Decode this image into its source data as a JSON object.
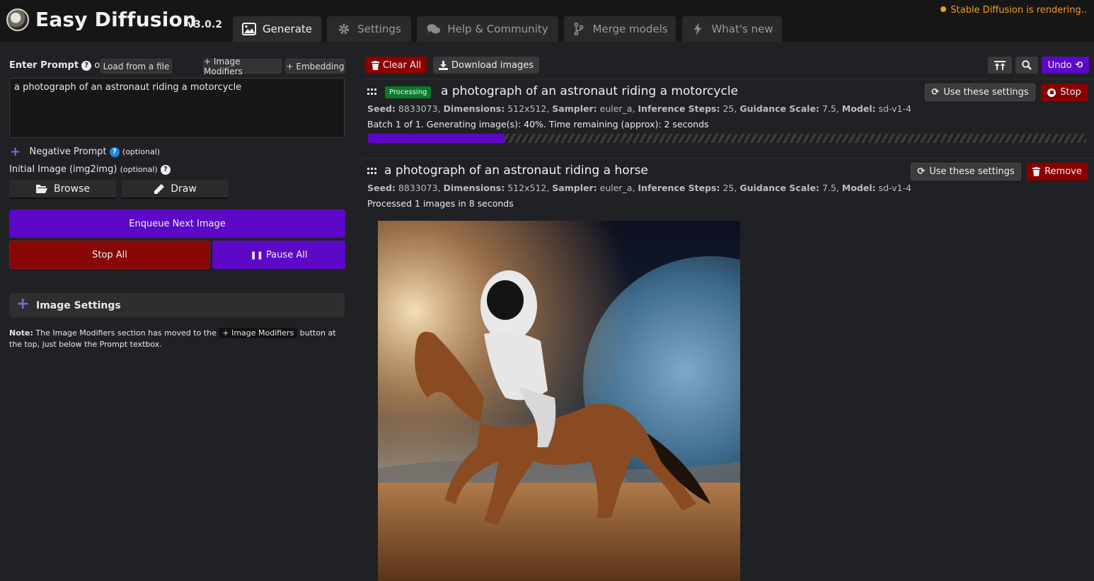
{
  "app": {
    "title": "Easy Diffusion",
    "version": "v3.0.2",
    "status": "Stable Diffusion is rendering.."
  },
  "tabs": [
    {
      "label": "Generate",
      "icon": "image-icon"
    },
    {
      "label": "Settings",
      "icon": "gear-icon"
    },
    {
      "label": "Help & Community",
      "icon": "comments-icon"
    },
    {
      "label": "Merge models",
      "icon": "code-branch-icon"
    },
    {
      "label": "What's new",
      "icon": "bolt-icon"
    }
  ],
  "left": {
    "enter_prompt": "Enter Prompt",
    "or": "or",
    "load_from_file": "Load from a file",
    "image_modifiers": "+ Image Modifiers",
    "embedding": "+ Embedding",
    "prompt_value": "a photograph of an astronaut riding a motorcycle",
    "negative_prompt": "Negative Prompt",
    "optional": "(optional)",
    "initial_image": "Initial Image (img2img)",
    "browse": "Browse",
    "draw": "Draw",
    "enqueue": "Enqueue Next Image",
    "stop_all": "Stop All",
    "pause_all": "Pause All",
    "image_settings": "Image Settings",
    "note_label": "Note:",
    "note_pre": "The Image Modifiers section has moved to the",
    "note_code": "+ Image Modifiers",
    "note_post": "button at the top, just below the Prompt textbox."
  },
  "toolbar": {
    "clear_all": "Clear All",
    "download_images": "Download images",
    "undo": "Undo"
  },
  "tasks": [
    {
      "status_badge": "Processing",
      "title": "a photograph of an astronaut riding a motorcycle",
      "seed_label": "Seed:",
      "seed": "8833073",
      "dims_label": "Dimensions:",
      "dims": "512x512",
      "sampler_label": "Sampler:",
      "sampler": "euler_a",
      "steps_label": "Inference Steps:",
      "steps": "25",
      "guidance_label": "Guidance Scale:",
      "guidance": "7.5",
      "model_label": "Model:",
      "model": "sd-v1-4",
      "progress_text": "Batch 1 of 1. Generating image(s): 40%. Time remaining (approx): 2 seconds",
      "progress": 0.19,
      "use_settings": "Use these settings",
      "action": "Stop"
    },
    {
      "title": "a photograph of an astronaut riding a horse",
      "seed_label": "Seed:",
      "seed": "8833073",
      "dims_label": "Dimensions:",
      "dims": "512x512",
      "sampler_label": "Sampler:",
      "sampler": "euler_a",
      "steps_label": "Inference Steps:",
      "steps": "25",
      "guidance_label": "Guidance Scale:",
      "guidance": "7.5",
      "model_label": "Model:",
      "model": "sd-v1-4",
      "progress_text": "Processed 1 images in 8 seconds",
      "use_settings": "Use these settings",
      "action": "Remove"
    }
  ],
  "colors": {
    "accent": "#5d07c7",
    "danger": "#870806",
    "status": "#f0a020",
    "processing": "#0b7a2c"
  }
}
